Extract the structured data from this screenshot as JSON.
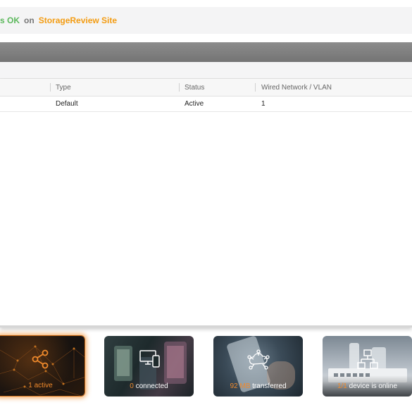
{
  "header": {
    "status_text": "s OK",
    "connector": "on",
    "site_name": "StorageReview Site"
  },
  "table": {
    "columns": [
      "Type",
      "Status",
      "Wired Network / VLAN"
    ],
    "rows": [
      {
        "type": "Default",
        "status": "Active",
        "vlan": "1"
      }
    ]
  },
  "cards": [
    {
      "number": "1",
      "text": "active",
      "icon": "network-share-icon",
      "highlighted": true
    },
    {
      "number": "0",
      "text": "connected",
      "icon": "devices-icon"
    },
    {
      "number": "92 MB",
      "text": "transferred",
      "icon": "cloud-traffic-icon"
    },
    {
      "number": "1/1",
      "text": "device is online",
      "icon": "network-topology-icon"
    }
  ],
  "colors": {
    "ok_green": "#5cb85c",
    "accent_orange": "#f39c12",
    "card_number_orange": "#f08a2c"
  }
}
